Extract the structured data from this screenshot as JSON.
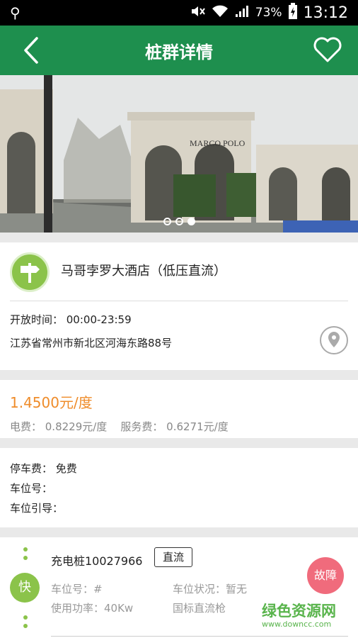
{
  "status_bar": {
    "battery": "73%",
    "time": "13:12"
  },
  "header": {
    "title": "桩群详情"
  },
  "banner": {
    "sign_text": "MARCO POLO",
    "dots": 3,
    "active_dot": 3
  },
  "station": {
    "name": "马哥孛罗大酒店（低压直流）",
    "hours": "开放时间： 00:00-23:59",
    "address": "江苏省常州市新北区河海东路88号"
  },
  "price": {
    "total": "1.4500元/度",
    "detail": "电费： 0.8229元/度    服务费： 0.6271元/度"
  },
  "parking": {
    "fee": "停车费： 免费",
    "space_no": "车位号：",
    "guide": "车位引导："
  },
  "charger": {
    "speed": "快",
    "name": "充电桩10027966",
    "type": "直流",
    "space": "车位号：#",
    "status": "车位状况：暂无",
    "power": "使用功率：40Kw",
    "gun": "国标直流枪",
    "fault": "故障"
  },
  "watermark": {
    "line1": "绿色资源网",
    "line2": "www.downcc.com"
  },
  "colors": {
    "brand_green": "#1e8f4e",
    "price_orange": "#ef8c2a",
    "leaf_green": "#8bc34a",
    "fault_pink": "#f06b7c"
  }
}
